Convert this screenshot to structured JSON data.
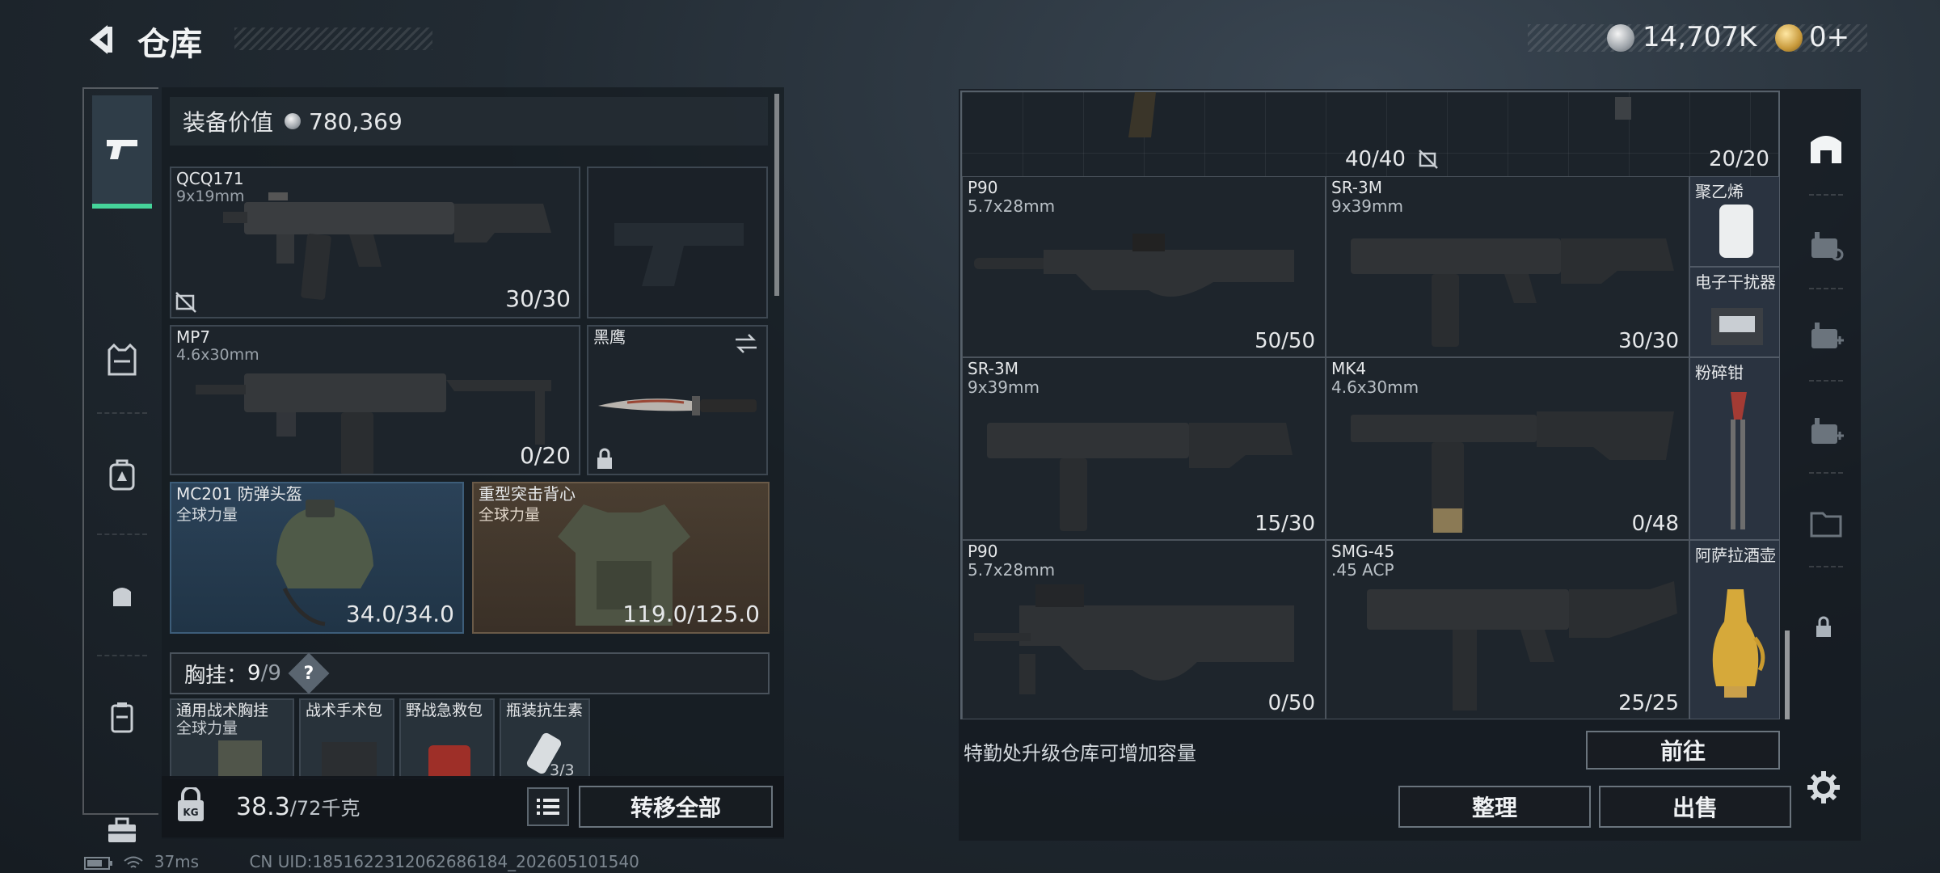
{
  "header": {
    "title": "仓库",
    "currency_silver": "14,707K",
    "currency_gold": "0+"
  },
  "left": {
    "equip_value_label": "装备价值",
    "equip_value": "780,369",
    "primary": {
      "name": "QCQ171",
      "caliber": "9x19mm",
      "ammo": "30/30"
    },
    "secondary": {
      "name": "MP7",
      "caliber": "4.6x30mm",
      "ammo": "0/20"
    },
    "melee": {
      "name": "黑鹰"
    },
    "helmet": {
      "name": "MC201 防弹头盔",
      "tag": "全球力量",
      "durability": "34.0/34.0"
    },
    "vest": {
      "name": "重型突击背心",
      "tag": "全球力量",
      "durability": "119.0/125.0"
    },
    "rig_label": "胸挂：",
    "rig_count": "9",
    "rig_total": "/9",
    "rig_items": [
      {
        "name": "通用战术胸挂",
        "tag": "全球力量"
      },
      {
        "name": "战术手术包"
      },
      {
        "name": "野战急救包"
      },
      {
        "name": "瓶装抗生素",
        "count": "3/3"
      }
    ],
    "weight": "38.3",
    "weight_max": "/72千克",
    "transfer_all": "转移全部"
  },
  "right": {
    "top_ammo_1": "40/40",
    "top_ammo_2": "20/20",
    "items": [
      {
        "name": "P90",
        "caliber": "5.7x28mm",
        "ammo": "50/50"
      },
      {
        "name": "SR-3M",
        "caliber": "9x39mm",
        "ammo": "30/30"
      },
      {
        "name": "SR-3M",
        "caliber": "9x39mm",
        "ammo": "15/30"
      },
      {
        "name": "MK4",
        "caliber": "4.6x30mm",
        "ammo": "0/48"
      },
      {
        "name": "P90",
        "caliber": "5.7x28mm",
        "ammo": "0/50"
      },
      {
        "name": "SMG-45",
        "caliber": ".45 ACP",
        "ammo": "25/25"
      }
    ],
    "small_items": [
      "聚乙烯",
      "电子干扰器",
      "粉碎钳",
      "阿萨拉酒壶"
    ],
    "upgrade_hint": "特勤处升级仓库可增加容量",
    "goto": "前往",
    "sort": "整理",
    "sell": "出售"
  },
  "status": {
    "ping": "37ms",
    "uid": "CN UID:1851622312062686184_202605101540"
  },
  "colors": {
    "accent": "#45d49a",
    "helmet_bg": "#2b4258",
    "vest_bg": "#4a3e31"
  }
}
